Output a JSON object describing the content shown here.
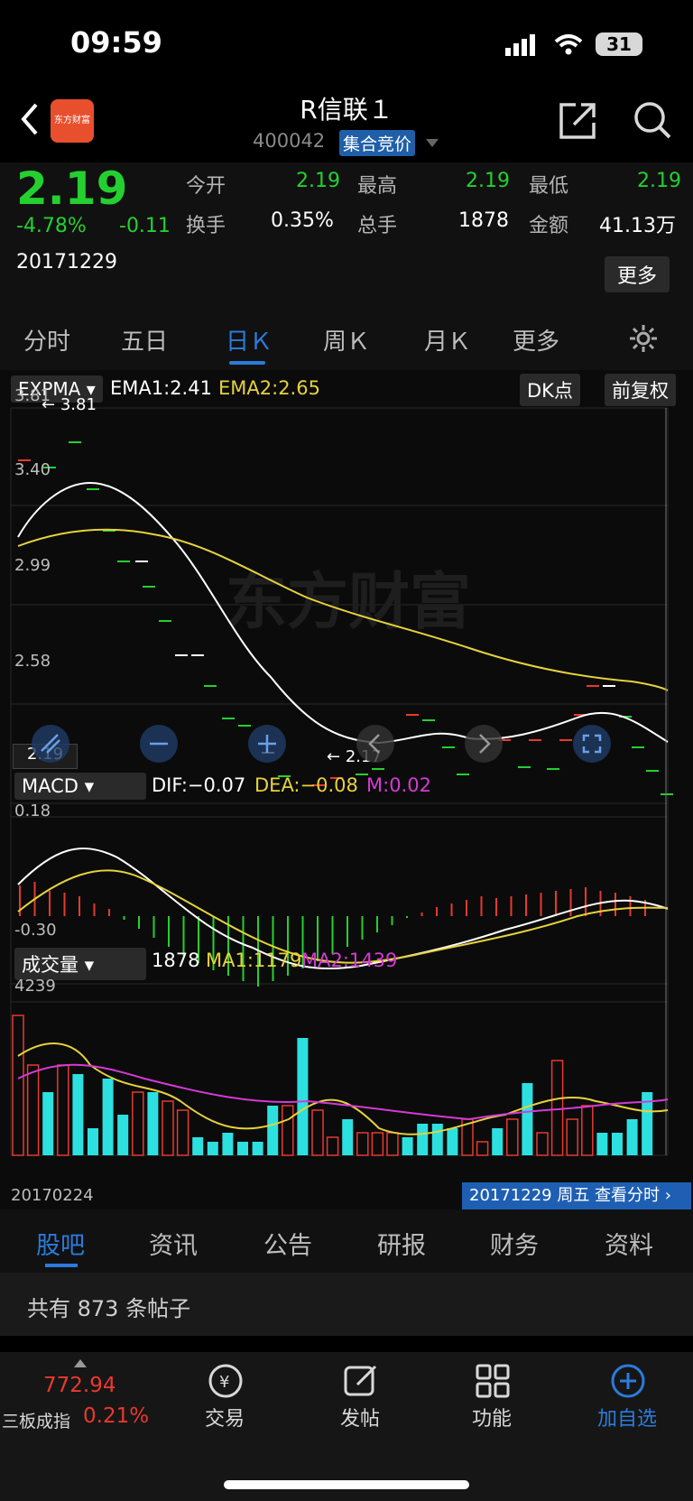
{
  "status": {
    "time": "09:59",
    "battery": "31"
  },
  "header": {
    "title": "R信联１",
    "code": "400042",
    "auction_badge": "集合竞价",
    "logo_text": "东方财富"
  },
  "quote": {
    "price": "2.19",
    "change_pct": "-4.78%",
    "change": "-0.11",
    "date": "20171229",
    "open_label": "今开",
    "open": "2.19",
    "high_label": "最高",
    "high": "2.19",
    "low_label": "最低",
    "low": "2.19",
    "turnover_label": "换手",
    "turnover": "0.35%",
    "volume_label": "总手",
    "volume": "1878",
    "amount_label": "金额",
    "amount": "41.13万",
    "more_button": "更多"
  },
  "chart_tabs": [
    "分时",
    "五日",
    "日Ｋ",
    "周Ｋ",
    "月Ｋ",
    "更多"
  ],
  "chart_tab_active": 2,
  "indicator": {
    "main": "EXPMA",
    "ema1": "EMA1:2.41",
    "ema2": "EMA2:2.65",
    "dk_button": "DK点",
    "fq_button": "前复权",
    "price_ticks": [
      "3.81",
      "3.40",
      "2.99",
      "2.58"
    ],
    "max_label": "3.81",
    "min_label": "2.17",
    "current_price_label": "2.19"
  },
  "macd": {
    "name": "MACD",
    "dif": "DIF:−0.07",
    "dea": "DEA:−0.08",
    "m": "M:0.02",
    "top": "0.18",
    "bottom": "-0.30"
  },
  "vol": {
    "name": "成交量",
    "value": "1878",
    "ma1": "MA1:1179",
    "ma2": "MA2:1439",
    "max": "4239",
    "start_date": "20170224",
    "end_info": "20171229 周五 查看分时"
  },
  "chart_data": {
    "type": "line",
    "x_range": [
      "20170224",
      "20171229"
    ],
    "price_ylim": [
      2.17,
      3.81
    ],
    "macd_ylim": [
      -0.3,
      0.18
    ],
    "volume_max": 4239,
    "series": [
      {
        "name": "EMA1",
        "last": 2.41
      },
      {
        "name": "EMA2",
        "last": 2.65
      },
      {
        "name": "DIF",
        "last": -0.07
      },
      {
        "name": "DEA",
        "last": -0.08
      },
      {
        "name": "M",
        "last": 0.02
      },
      {
        "name": "MA1",
        "last": 1179
      },
      {
        "name": "MA2",
        "last": 1439
      }
    ]
  },
  "info_tabs": [
    "股吧",
    "资讯",
    "公告",
    "研报",
    "财务",
    "资料"
  ],
  "post_count_text": "共有 873 条帖子",
  "bottom_nav": {
    "index_value": "772.94",
    "index_name": "三板成指",
    "index_pct": "0.21%",
    "trade": "交易",
    "post": "发帖",
    "func": "功能",
    "add": "加自选"
  },
  "colors": {
    "up": "#e8392e",
    "down": "#24d02f",
    "accent": "#2b7bdc",
    "ema1": "#ffffff",
    "ema2": "#e6d23c",
    "m": "#d53ad5"
  }
}
